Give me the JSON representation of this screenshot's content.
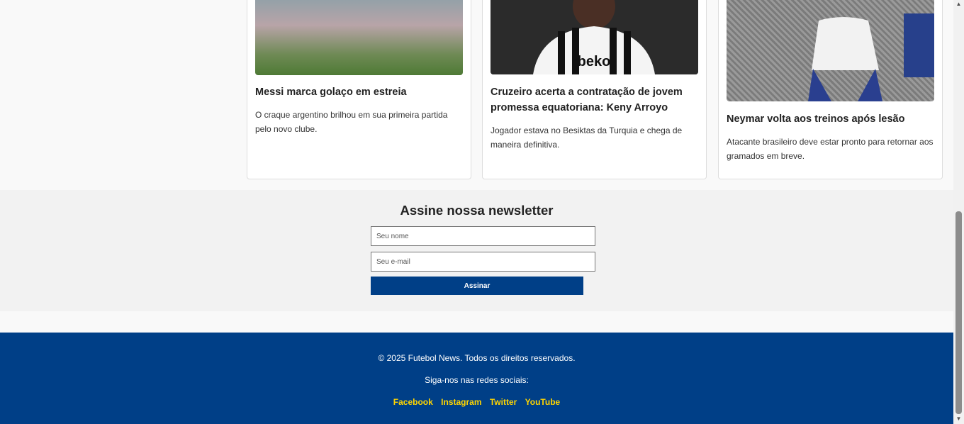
{
  "cards": [
    {
      "title": "Messi marca golaço em estreia",
      "text": "O craque argentino brilhou em sua primeira partida pelo novo clube."
    },
    {
      "title": "Cruzeiro acerta a contratação de jovem promessa equatoriana: Keny Arroyo",
      "text": "Jogador estava no Besiktas da Turquia e chega de maneira definitiva."
    },
    {
      "title": "Neymar volta aos treinos após lesão",
      "text": "Atacante brasileiro deve estar pronto para retornar aos gramados em breve."
    }
  ],
  "newsletter": {
    "title": "Assine nossa newsletter",
    "name_placeholder": "Seu nome",
    "email_placeholder": "Seu e-mail",
    "button": "Assinar"
  },
  "footer": {
    "copyright": "© 2025 Futebol News. Todos os direitos reservados.",
    "follow": "Siga-nos nas redes sociais:",
    "links": [
      "Facebook",
      "Instagram",
      "Twitter",
      "YouTube"
    ],
    "link_color": "#ffd500",
    "bg_color": "#003f87"
  }
}
